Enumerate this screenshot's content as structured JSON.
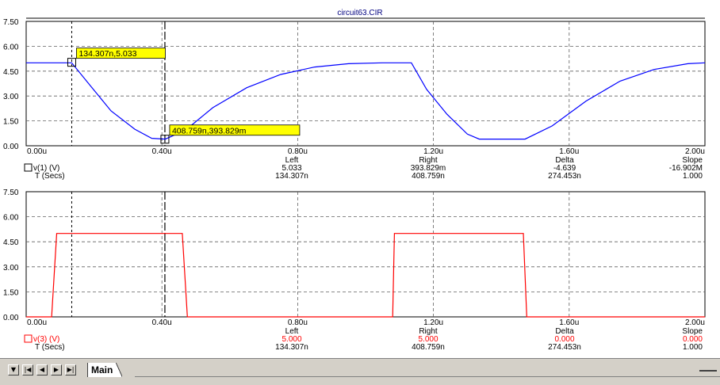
{
  "title": "circuit63.CIR",
  "tab": {
    "label": "Main"
  },
  "x_ticks": [
    "0.00u",
    "0.40u",
    "0.80u",
    "1.20u",
    "1.60u",
    "2.00u"
  ],
  "top_plot": {
    "y_ticks": [
      "7.50",
      "6.00",
      "4.50",
      "3.00",
      "1.50",
      "0.00"
    ],
    "trace_label": "v(1) (V)",
    "trace_color": "#0000ff",
    "cursor1_label": "134.307n,5.033",
    "cursor2_label": "408.759n,393.829m",
    "readout": {
      "headers": [
        "Left",
        "Right",
        "Delta",
        "Slope"
      ],
      "y_row": [
        "5.033",
        "393.829m",
        "-4.639",
        "-16.902M"
      ],
      "x_label": "T (Secs)",
      "x_row": [
        "134.307n",
        "408.759n",
        "274.453n",
        "1.000"
      ]
    }
  },
  "bottom_plot": {
    "y_ticks": [
      "7.50",
      "6.00",
      "4.50",
      "3.00",
      "1.50",
      "0.00"
    ],
    "trace_label": "v(3) (V)",
    "trace_color": "#ff0000",
    "readout": {
      "headers": [
        "Left",
        "Right",
        "Delta",
        "Slope"
      ],
      "y_row": [
        "5.000",
        "5.000",
        "0.000",
        "0.000"
      ],
      "x_label": "T (Secs)",
      "x_row": [
        "134.307n",
        "408.759n",
        "274.453n",
        "1.000"
      ]
    }
  },
  "chart_data": [
    {
      "type": "line",
      "title": "circuit63.CIR",
      "xlabel": "T (Secs)",
      "ylabel": "v(1) (V)",
      "xlim": [
        0,
        2.0
      ],
      "ylim": [
        0,
        7.5
      ],
      "x_unit": "u",
      "series": [
        {
          "name": "v(1) (V)",
          "color": "#0000ff",
          "x": [
            0,
            0.134,
            0.19,
            0.25,
            0.32,
            0.37,
            0.41,
            0.47,
            0.55,
            0.65,
            0.75,
            0.85,
            0.95,
            1.05,
            1.135,
            1.18,
            1.24,
            1.3,
            1.335,
            1.4,
            1.47,
            1.55,
            1.65,
            1.75,
            1.85,
            1.95,
            2.0
          ],
          "y": [
            5.0,
            5.0,
            3.6,
            2.1,
            1.0,
            0.45,
            0.4,
            0.95,
            2.3,
            3.5,
            4.3,
            4.75,
            4.95,
            5.0,
            5.0,
            3.4,
            1.9,
            0.7,
            0.4,
            0.4,
            0.4,
            1.2,
            2.7,
            3.9,
            4.6,
            4.95,
            5.0
          ]
        }
      ],
      "cursors": [
        {
          "x": 0.134307,
          "y": 5.033
        },
        {
          "x": 0.408759,
          "y": 0.393829
        }
      ],
      "grid": true
    },
    {
      "type": "line",
      "xlabel": "T (Secs)",
      "ylabel": "v(3) (V)",
      "xlim": [
        0,
        2.0
      ],
      "ylim": [
        0,
        7.5
      ],
      "x_unit": "u",
      "series": [
        {
          "name": "v(3) (V)",
          "color": "#ff0000",
          "x": [
            0,
            0.075,
            0.09,
            0.46,
            0.475,
            1.07,
            1.08,
            1.085,
            1.465,
            1.475,
            2.0
          ],
          "y": [
            0,
            0,
            5.0,
            5.0,
            0,
            0,
            0,
            5.0,
            5.0,
            0,
            0
          ]
        }
      ],
      "cursors": [
        {
          "x": 0.134307,
          "y": 5.0
        },
        {
          "x": 0.408759,
          "y": 5.0
        }
      ],
      "grid": true
    }
  ]
}
